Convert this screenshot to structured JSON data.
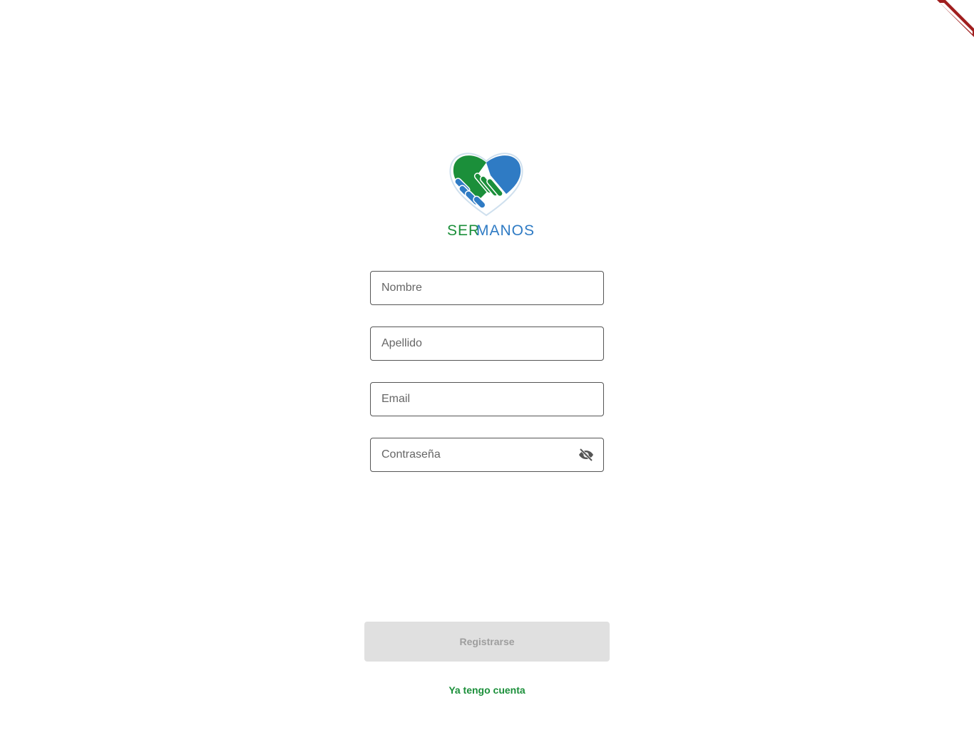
{
  "brand": {
    "name_part1": "SER",
    "name_part2": "MANOS",
    "color_green": "#1b8f3a",
    "color_blue": "#2f7bc4"
  },
  "form": {
    "nombre_placeholder": "Nombre",
    "apellido_placeholder": "Apellido",
    "email_placeholder": "Email",
    "password_placeholder": "Contraseña",
    "password_toggle_icon": "visibility-off-icon"
  },
  "actions": {
    "register_label": "Registrarse",
    "login_link_label": "Ya tengo cuenta"
  },
  "debug_banner": {
    "color": "#a01e1e"
  }
}
